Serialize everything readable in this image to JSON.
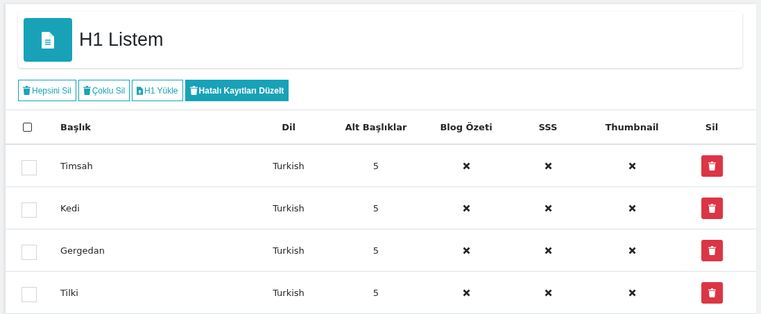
{
  "page_title": "H1 Listem",
  "toolbar": [
    {
      "label": "Hepsini Sil",
      "kind": "trash",
      "primary": false
    },
    {
      "label": "Çoklu Sil",
      "kind": "trash",
      "primary": false
    },
    {
      "label": "H1 Yükle",
      "kind": "upload",
      "primary": false
    },
    {
      "label": "Hatalı Kayıtları Düzelt",
      "kind": "trash",
      "primary": true
    }
  ],
  "table": {
    "select_all_checked": false,
    "columns": [
      "Başlık",
      "Dil",
      "Alt Başlıklar",
      "Blog Özeti",
      "SSS",
      "Thumbnail",
      "Sil"
    ],
    "rows": [
      {
        "checked": false,
        "title": "Timsah",
        "language": "Turkish",
        "subheadings": "5",
        "blog_summary": false,
        "faq": false,
        "thumbnail": false
      },
      {
        "checked": false,
        "title": "Kedi",
        "language": "Turkish",
        "subheadings": "5",
        "blog_summary": false,
        "faq": false,
        "thumbnail": false
      },
      {
        "checked": false,
        "title": "Gergedan",
        "language": "Turkish",
        "subheadings": "5",
        "blog_summary": false,
        "faq": false,
        "thumbnail": false
      },
      {
        "checked": false,
        "title": "Tilki",
        "language": "Turkish",
        "subheadings": "5",
        "blog_summary": false,
        "faq": false,
        "thumbnail": false
      }
    ]
  }
}
